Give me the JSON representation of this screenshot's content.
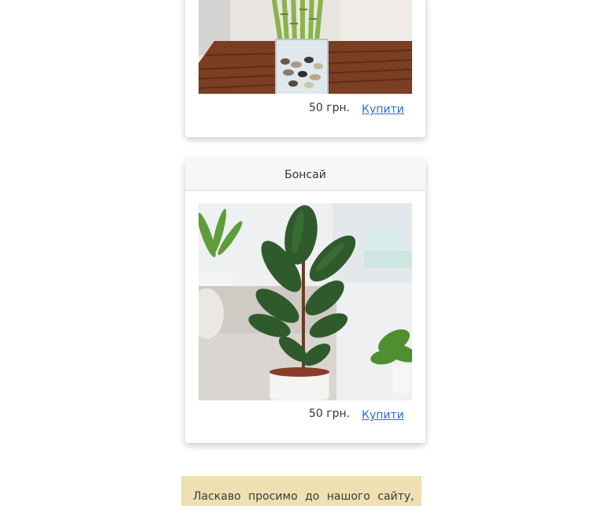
{
  "products": [
    {
      "name": "",
      "price": "50 грн.",
      "buy_label": "Купити",
      "image_icon": "lucky-bamboo-photo"
    },
    {
      "name": "Бонсай",
      "price": "50 грн.",
      "buy_label": "Купити",
      "image_icon": "rubber-plant-photo"
    }
  ],
  "welcome": {
    "text": "Ласкаво просимо до нашого сайту,"
  },
  "colors": {
    "link": "#2a6fd1",
    "welcome_bg": "#efe0b2",
    "card_header_bg": "#f7f7f7"
  }
}
